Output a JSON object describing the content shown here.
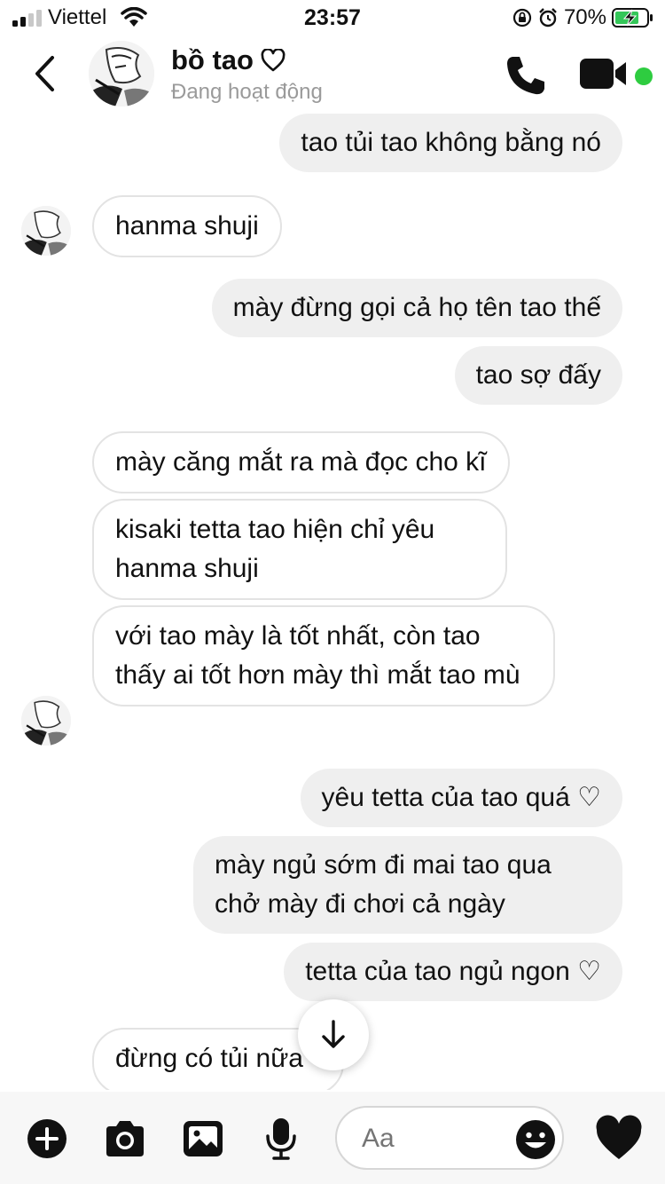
{
  "status_bar": {
    "carrier": "Viettel",
    "time": "23:57",
    "battery": "70%"
  },
  "header": {
    "contact_name": "bồ tao",
    "name_icon": "heart-outline-icon",
    "status": "Đang hoạt động",
    "online_color": "#2ecc40"
  },
  "messages": [
    {
      "side": "out",
      "text": "tao tủi tao không bằng nó"
    },
    {
      "side": "in",
      "text": "hanma shuji"
    },
    {
      "side": "out",
      "text": "mày đừng gọi cả họ tên tao thế"
    },
    {
      "side": "out",
      "text": "tao sợ đấy"
    },
    {
      "side": "in",
      "text": "mày căng mắt ra mà đọc cho kĩ"
    },
    {
      "side": "in",
      "text": "kisaki tetta tao hiện chỉ yêu hanma shuji"
    },
    {
      "side": "in",
      "text": "với tao mày là tốt nhất, còn tao thấy ai tốt hơn mày thì mắt tao mù"
    },
    {
      "side": "out",
      "text": "yêu tetta của tao quá ♡"
    },
    {
      "side": "out",
      "text": "mày ngủ sớm đi mai tao qua chở mày đi chơi cả ngày"
    },
    {
      "side": "out",
      "text": "tetta của tao ngủ ngon ♡"
    },
    {
      "side": "in",
      "text": "đừng có tủi nữa"
    }
  ],
  "composer": {
    "placeholder": "Aa",
    "icons": [
      "plus-icon",
      "camera-icon",
      "image-icon",
      "microphone-icon",
      "emoji-icon",
      "heart-icon"
    ]
  },
  "colors": {
    "outgoing_bubble": "#efefef",
    "incoming_border": "#e3e3e3"
  }
}
